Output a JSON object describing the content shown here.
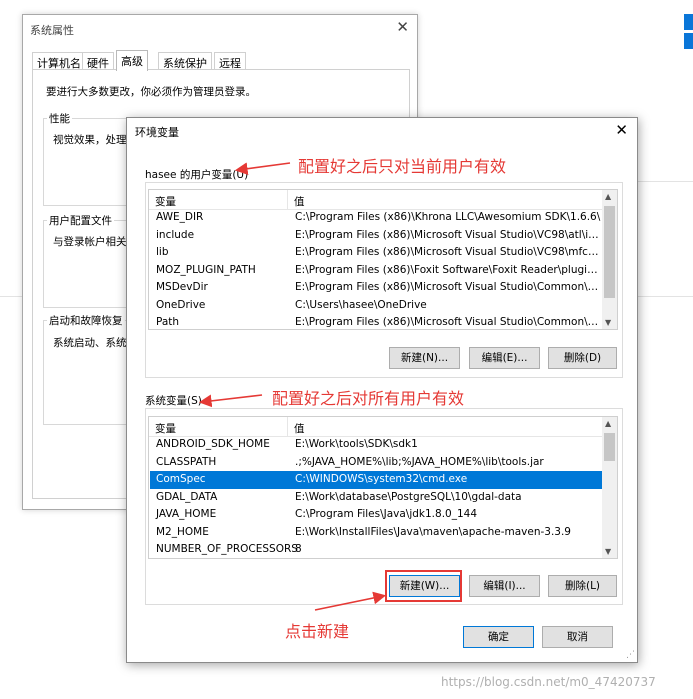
{
  "system_properties": {
    "title": "系统属性",
    "tabs": [
      "计算机名",
      "硬件",
      "高级",
      "系统保护",
      "远程"
    ],
    "admin_note": "要进行大多数更改，你必须作为管理员登录。",
    "performance": {
      "label": "性能",
      "desc": "视觉效果，处理器"
    },
    "user_profiles": {
      "label": "用户配置文件",
      "desc": "与登录帐户相关的"
    },
    "startup": {
      "label": "启动和故障恢复",
      "desc": "系统启动、系统故"
    }
  },
  "env_dialog": {
    "title": "环境变量",
    "user_section_label": "hasee 的用户变量(U)",
    "system_section_label": "系统变量(S)",
    "col_var": "变量",
    "col_val": "值",
    "user_vars": [
      {
        "name": "AWE_DIR",
        "value": "C:\\Program Files (x86)\\Khrona LLC\\Awesomium SDK\\1.6.6\\"
      },
      {
        "name": "include",
        "value": "E:\\Program Files (x86)\\Microsoft Visual Studio\\VC98\\atl\\inclu..."
      },
      {
        "name": "lib",
        "value": "E:\\Program Files (x86)\\Microsoft Visual Studio\\VC98\\mfc\\lib;E..."
      },
      {
        "name": "MOZ_PLUGIN_PATH",
        "value": "E:\\Program Files (x86)\\Foxit Software\\Foxit Reader\\plugins\\"
      },
      {
        "name": "MSDevDir",
        "value": "E:\\Program Files (x86)\\Microsoft Visual Studio\\Common\\MS..."
      },
      {
        "name": "OneDrive",
        "value": "C:\\Users\\hasee\\OneDrive"
      },
      {
        "name": "Path",
        "value": "E:\\Program Files (x86)\\Microsoft Visual Studio\\Common\\Tool..."
      }
    ],
    "system_vars": [
      {
        "name": "ANDROID_SDK_HOME",
        "value": "E:\\Work\\tools\\SDK\\sdk1"
      },
      {
        "name": "CLASSPATH",
        "value": ".;%JAVA_HOME%\\lib;%JAVA_HOME%\\lib\\tools.jar"
      },
      {
        "name": "ComSpec",
        "value": "C:\\WINDOWS\\system32\\cmd.exe"
      },
      {
        "name": "GDAL_DATA",
        "value": "E:\\Work\\database\\PostgreSQL\\10\\gdal-data"
      },
      {
        "name": "JAVA_HOME",
        "value": "C:\\Program Files\\Java\\jdk1.8.0_144"
      },
      {
        "name": "M2_HOME",
        "value": "E:\\Work\\InstallFiles\\Java\\maven\\apache-maven-3.3.9"
      },
      {
        "name": "NUMBER_OF_PROCESSORS",
        "value": "8"
      }
    ],
    "selected_system_var": "ComSpec",
    "user_buttons": {
      "new": "新建(N)...",
      "edit": "编辑(E)...",
      "delete": "删除(D)"
    },
    "system_buttons": {
      "new": "新建(W)...",
      "edit": "编辑(I)...",
      "delete": "删除(L)"
    },
    "ok": "确定",
    "cancel": "取消"
  },
  "annotations": {
    "user_note": "配置好之后只对当前用户有效",
    "system_note": "配置好之后对所有用户有效",
    "click_note": "点击新建"
  },
  "watermark": "https://blog.csdn.net/m0_47420737",
  "colors": {
    "selection": "#0078d7",
    "annotation": "#e53935"
  }
}
